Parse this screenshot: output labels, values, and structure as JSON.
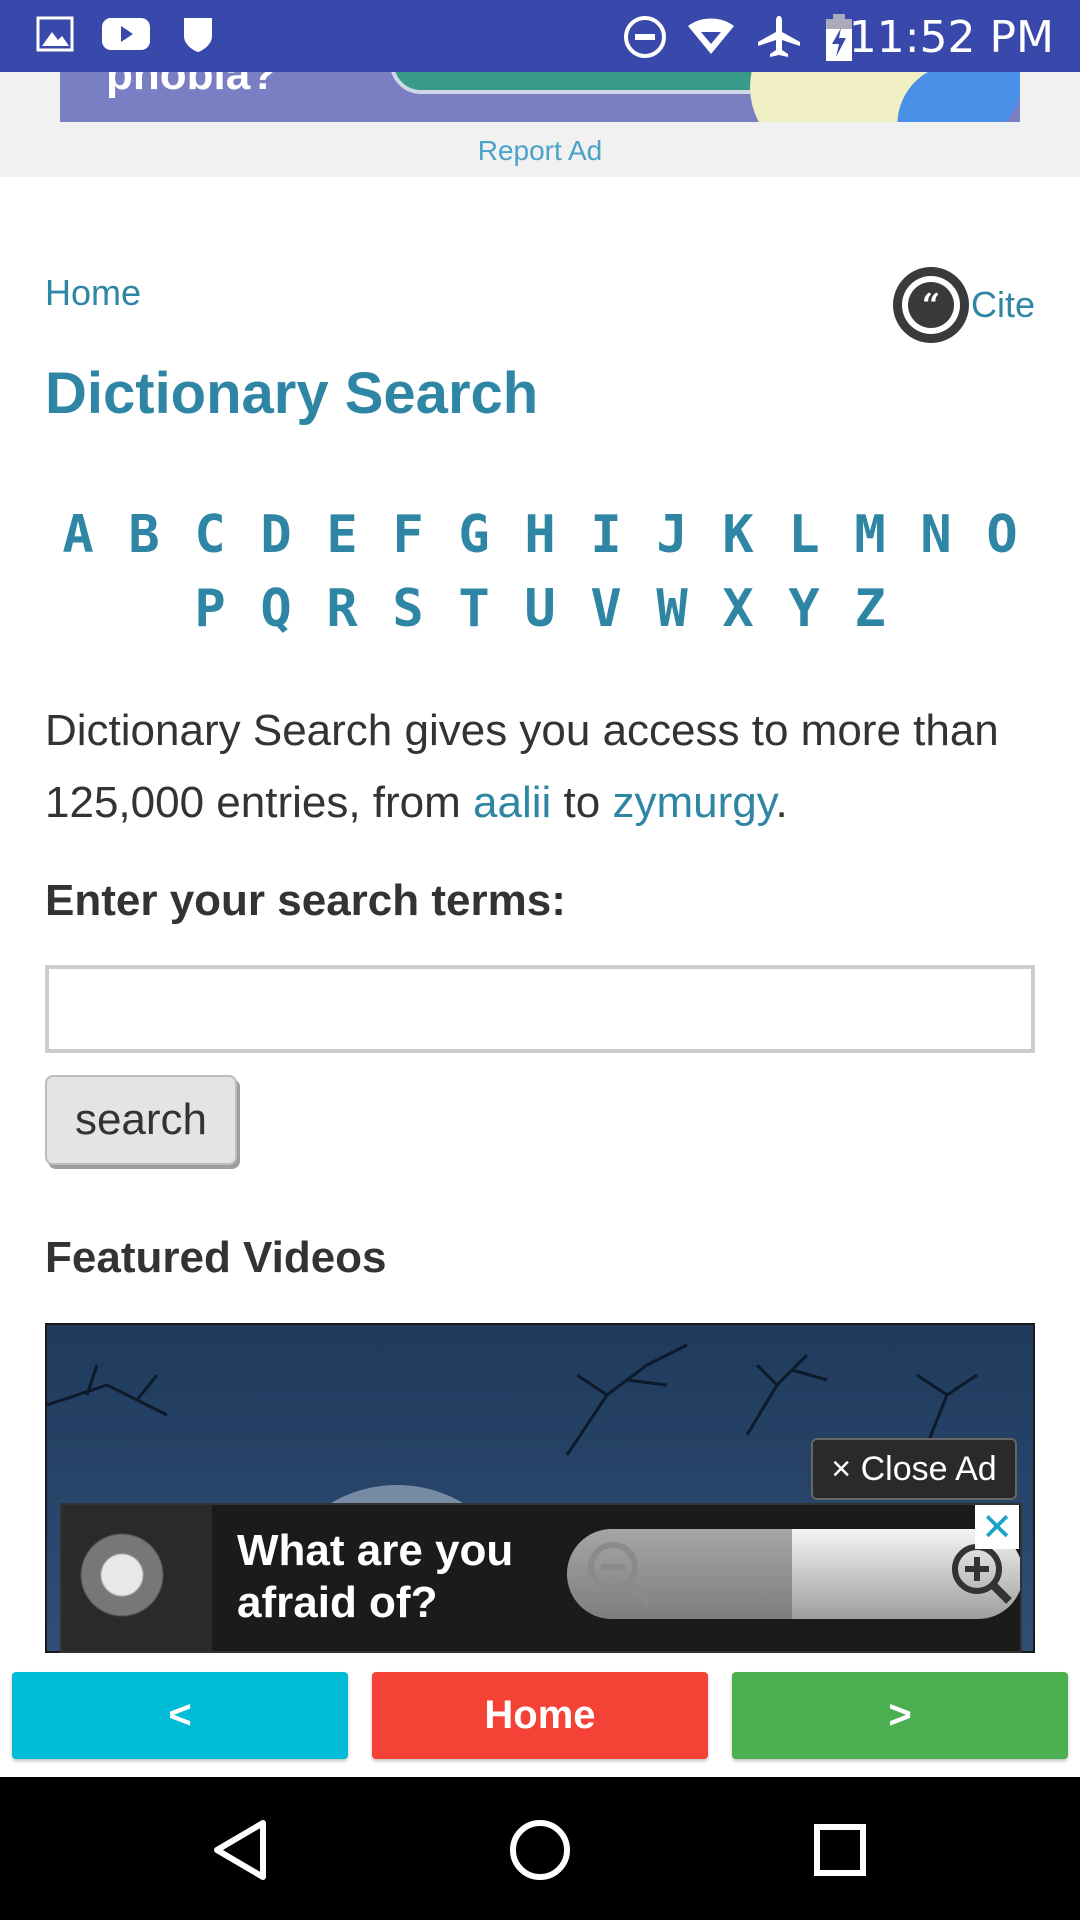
{
  "status_bar": {
    "time": "11:52 PM",
    "left_icons": [
      "image-icon",
      "youtube-icon",
      "shield-icon"
    ],
    "right_icons": [
      "do-not-disturb-icon",
      "wifi-icon",
      "airplane-mode-icon",
      "battery-charging-icon"
    ]
  },
  "top_ad": {
    "text": "phobia?",
    "report_label": "Report Ad"
  },
  "breadcrumb": {
    "home": "Home",
    "cite": "Cite",
    "cite_glyph": "“"
  },
  "page": {
    "title": "Dictionary Search"
  },
  "alphabet": {
    "row1": [
      "A",
      "B",
      "C",
      "D",
      "E",
      "F",
      "G",
      "H",
      "I",
      "J",
      "K",
      "L",
      "M",
      "N",
      "O"
    ],
    "row2": [
      "P",
      "Q",
      "R",
      "S",
      "T",
      "U",
      "V",
      "W",
      "X",
      "Y",
      "Z"
    ]
  },
  "intro": {
    "before": "Dictionary Search gives you access to more than 125,000 entries, from ",
    "link_first": "aalii",
    "middle": " to ",
    "link_last": "zymurgy",
    "after": "."
  },
  "search": {
    "label": "Enter your search terms:",
    "input_value": "",
    "input_placeholder": "",
    "button_label": "search"
  },
  "featured": {
    "title": "Featured Videos"
  },
  "video_ad": {
    "close_label": "× Close Ad",
    "question_line1": "What are you",
    "question_line2": "afraid of?",
    "x_label": "✕"
  },
  "nav_buttons": {
    "prev": "<",
    "home": "Home",
    "next": ">"
  },
  "colors": {
    "status_bar": "#3949ab",
    "link": "#2e86a4",
    "nav_prev": "#00bcd4",
    "nav_home": "#f44336",
    "nav_next": "#4caf50"
  }
}
